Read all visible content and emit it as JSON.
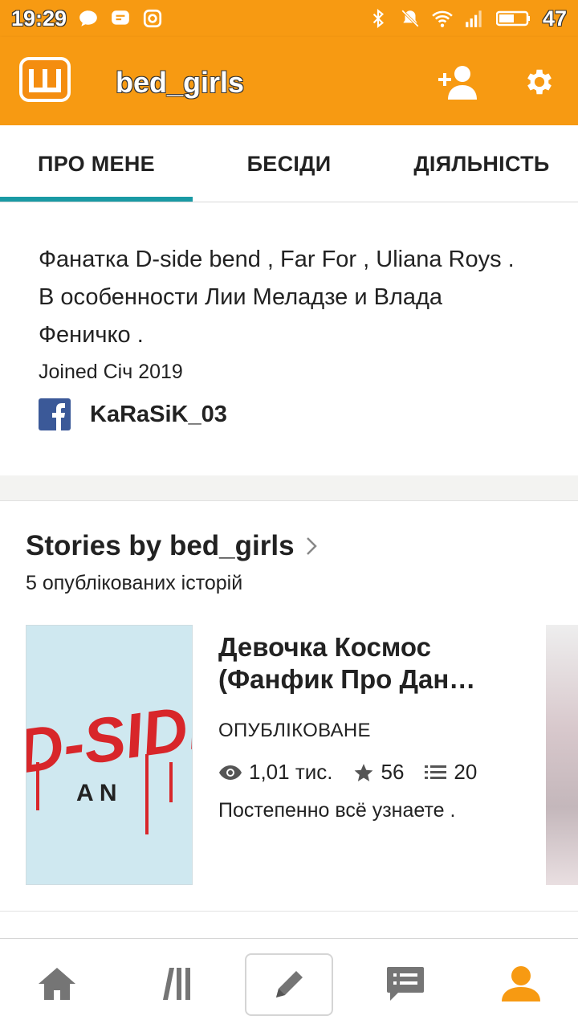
{
  "status_bar": {
    "time": "19:29",
    "battery": "47",
    "left_icons": [
      "chat-bubble-icon",
      "message-icon",
      "instagram-icon"
    ],
    "right_icons": [
      "bluetooth-icon",
      "mute-icon",
      "wifi-icon",
      "signal-icon",
      "battery-icon"
    ]
  },
  "app_bar": {
    "username": "bed_girls",
    "logo_icon": "wattpad-logo",
    "actions": [
      "add-user-icon",
      "gear-icon"
    ]
  },
  "tabs": [
    {
      "label": "ПРО МЕНЕ",
      "active": true
    },
    {
      "label": "БЕСІДИ",
      "active": false
    },
    {
      "label": "ДІЯЛЬНІСТЬ",
      "active": false
    }
  ],
  "about": {
    "bio": "Фанатка D-side bend , Far For , Uliana Roys . В особенности Лии Меладзе и Влада Феничко .",
    "joined": "Joined Січ 2019",
    "facebook_name": "KaRaSiK_03"
  },
  "stories": {
    "title": "Stories by bed_girls",
    "count": "5 опублікованих історій",
    "items": [
      {
        "title": "Девочка Космос (Фанфик Про Дан…",
        "status": "ОПУБЛІКОВАНЕ",
        "reads": "1,01 тис.",
        "votes": "56",
        "parts": "20",
        "description": "Постепенно всё узнаете  .",
        "cover_text_top": "D-SIDE",
        "cover_text_bottom": "A N"
      }
    ]
  },
  "bottom_nav": [
    "home-icon",
    "library-icon",
    "write-icon",
    "messages-icon",
    "profile-icon"
  ],
  "colors": {
    "accent": "#f79a12",
    "tab_indicator": "#1a9aa4",
    "facebook": "#3b5998",
    "nav_icon": "#757575",
    "nav_active": "#f79a12"
  }
}
